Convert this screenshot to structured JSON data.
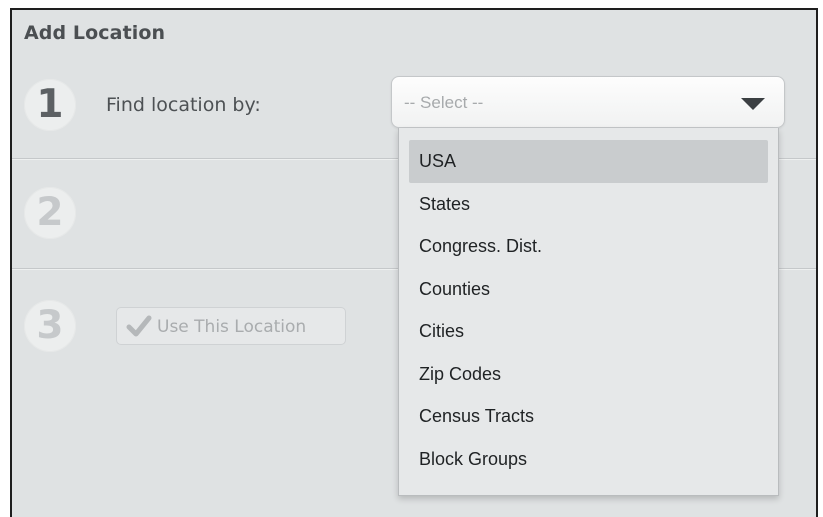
{
  "panel": {
    "title": "Add Location"
  },
  "steps": {
    "step1": {
      "number": "1",
      "label": "Find location by:"
    },
    "step2": {
      "number": "2"
    },
    "step3": {
      "number": "3",
      "button_label": "Use This Location",
      "button_icon": "checkmark-icon"
    }
  },
  "select": {
    "placeholder": "-- Select --",
    "arrow_icon": "caret-down-icon"
  },
  "dropdown": {
    "highlighted_index": 0,
    "options": [
      "USA",
      "States",
      "Congress. Dist.",
      "Counties",
      "Cities",
      "Zip Codes",
      "Census Tracts",
      "Block Groups"
    ]
  },
  "colors": {
    "panel_background": "#dfe2e3",
    "highlight": "#c9ccce",
    "active_step": "#5c6063",
    "inactive_step": "#c6c9cb"
  }
}
